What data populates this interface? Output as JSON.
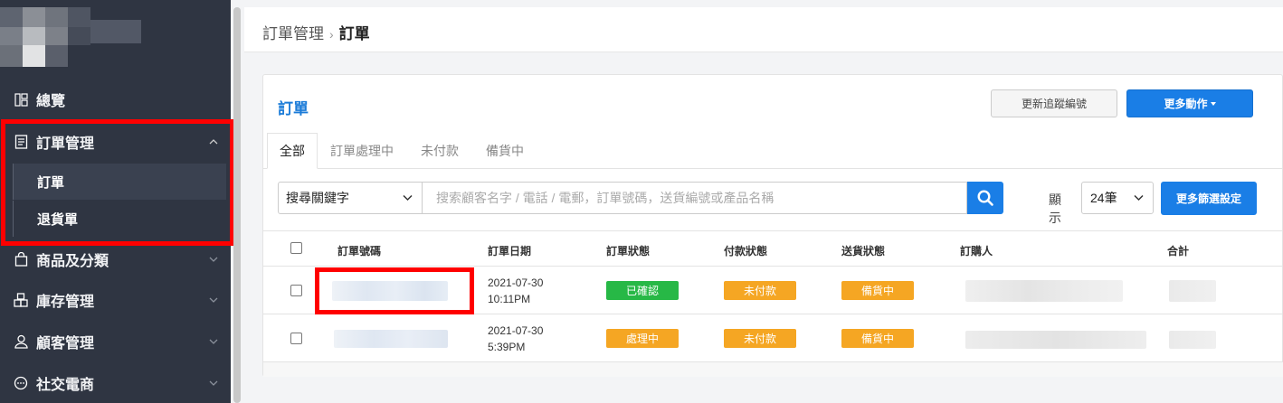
{
  "sidebar": {
    "items": [
      {
        "label": "總覽"
      },
      {
        "label": "訂單管理"
      },
      {
        "label": "商品及分類"
      },
      {
        "label": "庫存管理"
      },
      {
        "label": "顧客管理"
      },
      {
        "label": "社交電商"
      }
    ],
    "sub_items": [
      {
        "label": "訂單"
      },
      {
        "label": "退貨單"
      }
    ]
  },
  "breadcrumb": {
    "parent": "訂單管理",
    "separator": "›",
    "current": "訂單"
  },
  "card": {
    "title": "訂單",
    "update_tracking_label": "更新追蹤編號",
    "more_actions_label": "更多動作"
  },
  "tabs": [
    {
      "label": "全部"
    },
    {
      "label": "訂單處理中"
    },
    {
      "label": "未付款"
    },
    {
      "label": "備貨中"
    }
  ],
  "filter": {
    "keyword_select": "搜尋關鍵字",
    "search_placeholder": "搜索顧客名字 / 電話 / 電郵，訂單號碼，送貨編號或產品名稱",
    "show_label": "顯示",
    "show_value": "24筆",
    "more_filter_label": "更多篩選設定"
  },
  "table": {
    "columns": [
      "訂單號碼",
      "訂單日期",
      "訂單狀態",
      "付款狀態",
      "送貨狀態",
      "訂購人",
      "合計"
    ],
    "rows": [
      {
        "date": "2021-07-30",
        "time": "10:11PM",
        "order_status": "已確認",
        "payment_status": "未付款",
        "delivery_status": "備貨中"
      },
      {
        "date": "2021-07-30",
        "time": "5:39PM",
        "order_status": "處理中",
        "payment_status": "未付款",
        "delivery_status": "備貨中"
      }
    ]
  },
  "colors": {
    "sidebar_bg": "#2f3542",
    "accent_blue": "#1a7ee6",
    "badge_green": "#27b846",
    "badge_orange": "#f5a623",
    "highlight_red": "#ff0000"
  },
  "icons": {
    "overview": "dashboard-icon",
    "orders": "document-icon",
    "products": "bag-icon",
    "inventory": "boxes-icon",
    "customers": "user-icon",
    "social": "chat-icon",
    "search": "search-icon"
  }
}
